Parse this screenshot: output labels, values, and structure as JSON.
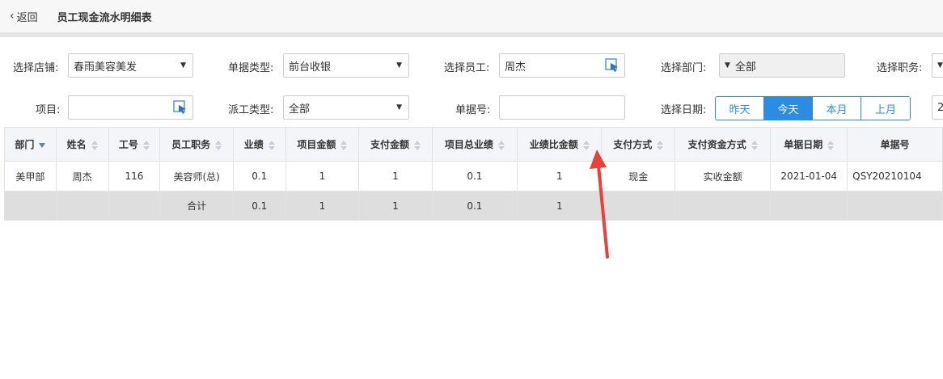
{
  "header": {
    "back_label": "返回",
    "title": "员工现金流水明细表"
  },
  "filters": {
    "store_label": "选择店铺:",
    "store_value": "春雨美容美发",
    "doc_type_label": "单据类型:",
    "doc_type_value": "前台收银",
    "staff_label": "选择员工:",
    "staff_value": "周杰",
    "dept_label": "选择部门:",
    "dept_value": "全部",
    "position_label": "选择职务:",
    "item_label": "项目:",
    "item_value": "",
    "dispatch_label": "派工类型:",
    "dispatch_value": "全部",
    "doc_no_label": "单据号:",
    "doc_no_value": "",
    "date_label": "选择日期:",
    "date_buttons": [
      "昨天",
      "今天",
      "本月",
      "上月"
    ],
    "active_date": "今天",
    "date_input_value": "2"
  },
  "table": {
    "columns": [
      "部门",
      "姓名",
      "工号",
      "员工职务",
      "业绩",
      "项目金额",
      "支付金额",
      "项目总业绩",
      "业绩比金额",
      "支付方式",
      "支付资金方式",
      "单据日期",
      "单据号"
    ],
    "rows": [
      [
        "美甲部",
        "周杰",
        "116",
        "美容师(总)",
        "0.1",
        "1",
        "1",
        "0.1",
        "1",
        "现金",
        "实收金额",
        "2021-01-04",
        "QSY20210104"
      ]
    ],
    "total_row": [
      "",
      "",
      "",
      "合计",
      "0.1",
      "1",
      "1",
      "0.1",
      "1",
      "",
      "",
      "",
      ""
    ]
  },
  "colors": {
    "accent": "#2c8ce4",
    "annotation_arrow": "#e8403a"
  }
}
